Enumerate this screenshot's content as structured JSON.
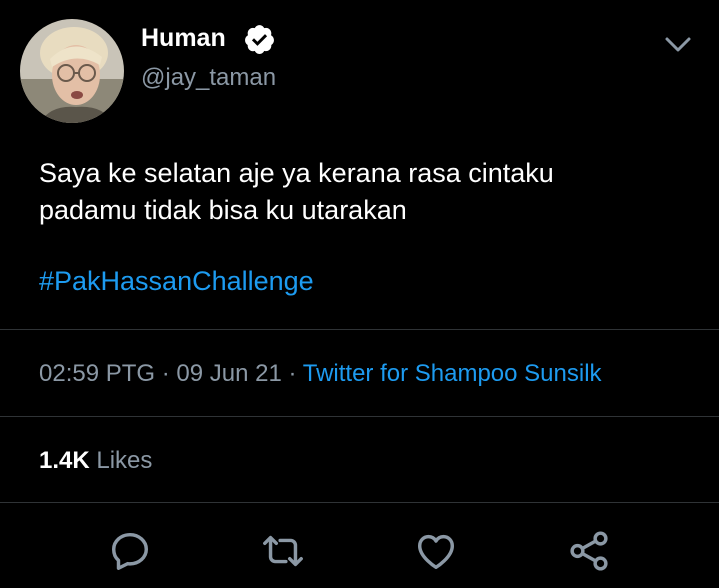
{
  "author": {
    "display_name": "Human",
    "handle": "@jay_taman",
    "verified": true,
    "avatar_icon": "avatar-photo"
  },
  "tweet": {
    "text_lines": [
      "Saya ke selatan aje ya kerana rasa cintaku",
      "padamu tidak bisa ku utarakan"
    ],
    "hashtag": "#PakHassanChallenge",
    "time": "02:59 PTG",
    "separator": "·",
    "date": "09 Jun 21",
    "source": "Twitter for Shampoo Sunsilk"
  },
  "stats": {
    "likes_count": "1.4K",
    "likes_label": "Likes"
  },
  "actions": [
    {
      "name": "reply",
      "icon": "reply-icon"
    },
    {
      "name": "retweet",
      "icon": "retweet-icon"
    },
    {
      "name": "like",
      "icon": "heart-icon"
    },
    {
      "name": "share",
      "icon": "share-icon"
    }
  ],
  "colors": {
    "background": "#000000",
    "text": "#ffffff",
    "secondary": "#8b98a5",
    "link": "#1d9bf0",
    "divider": "#2f3336"
  }
}
